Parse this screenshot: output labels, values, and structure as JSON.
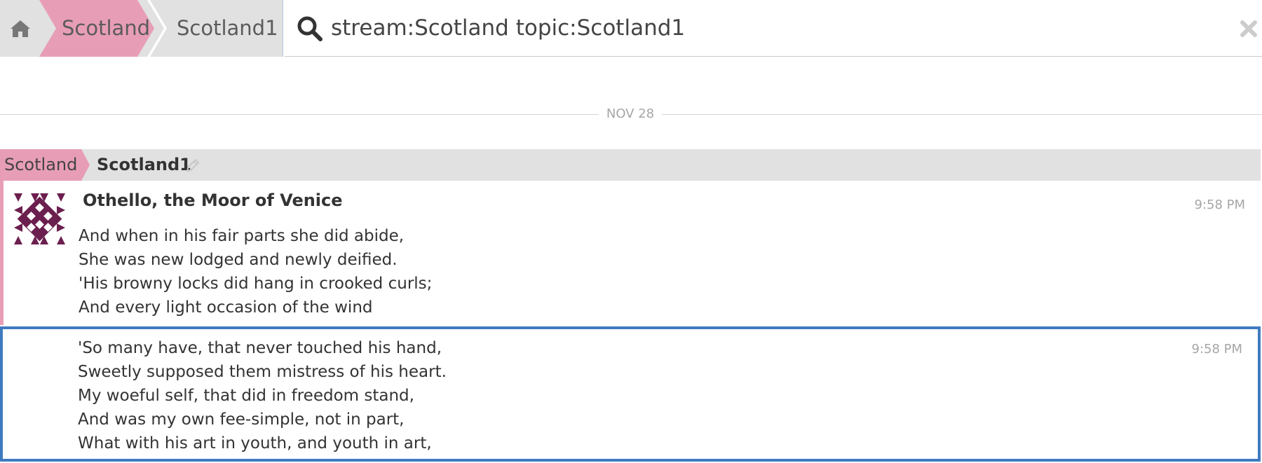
{
  "navbar": {
    "home_icon": "home-icon",
    "stream": "Scotland",
    "topic": "Scotland1"
  },
  "search": {
    "query": "stream:Scotland topic:Scotland1",
    "search_icon": "search-icon",
    "clear_icon": "close-icon"
  },
  "date_separator": "NOV 28",
  "recipient": {
    "stream": "Scotland",
    "topic": "Scotland1",
    "edit_icon": "pencil-icon"
  },
  "messages": [
    {
      "sender": "Othello, the Moor of Venice",
      "time": "9:58 PM",
      "lines": [
        "And when in his fair parts she did abide,",
        "She was new lodged and newly deified.",
        "'His browny locks did hang in crooked curls;",
        "And every light occasion of the wind"
      ]
    },
    {
      "time": "9:58 PM",
      "selected": true,
      "lines": [
        "'So many have, that never touched his hand,",
        "Sweetly supposed them mistress of his heart.",
        "My woeful self, that did in freedom stand,",
        "And was my own fee-simple, not in part,",
        "What with his art in youth, and youth in art,"
      ]
    }
  ],
  "colors": {
    "stream": "#e89db6",
    "avatar": "#6b1f4e",
    "selected_border": "#3f7ac0",
    "header_bg": "#e1e1e1"
  }
}
